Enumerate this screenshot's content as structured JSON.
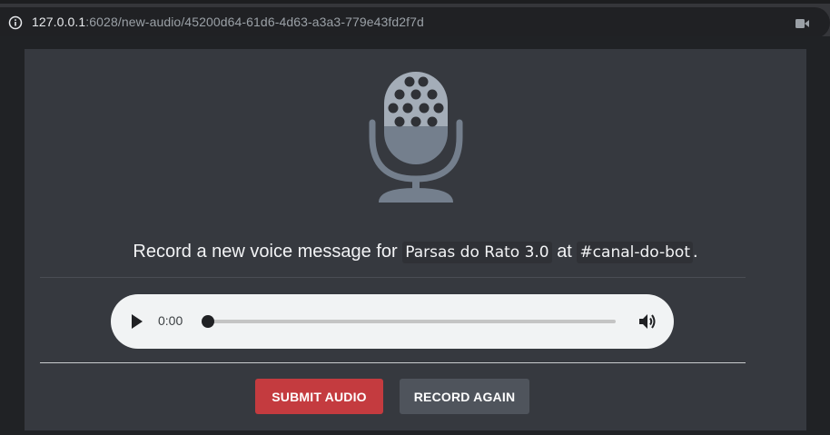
{
  "browser": {
    "url_host": "127.0.0.1",
    "url_path": ":6028/new-audio/45200d64-61d6-4d63-a3a3-779e43fd2f7d",
    "icons": [
      "info-icon",
      "video-camera-icon"
    ]
  },
  "colors": {
    "card_bg": "#36393f",
    "submit_bg": "#c43b3f",
    "record_again_bg": "#4f545c",
    "mic_color": "#747f8d"
  },
  "prompt": {
    "prefix": "Record a new voice message for",
    "server": "Parsas do Rato 3.0",
    "middle": "at",
    "channel": "#canal-do-bot",
    "suffix": "."
  },
  "player": {
    "current_time": "0:00",
    "progress": 0
  },
  "actions": {
    "submit_label": "SUBMIT AUDIO",
    "record_again_label": "RECORD AGAIN"
  }
}
